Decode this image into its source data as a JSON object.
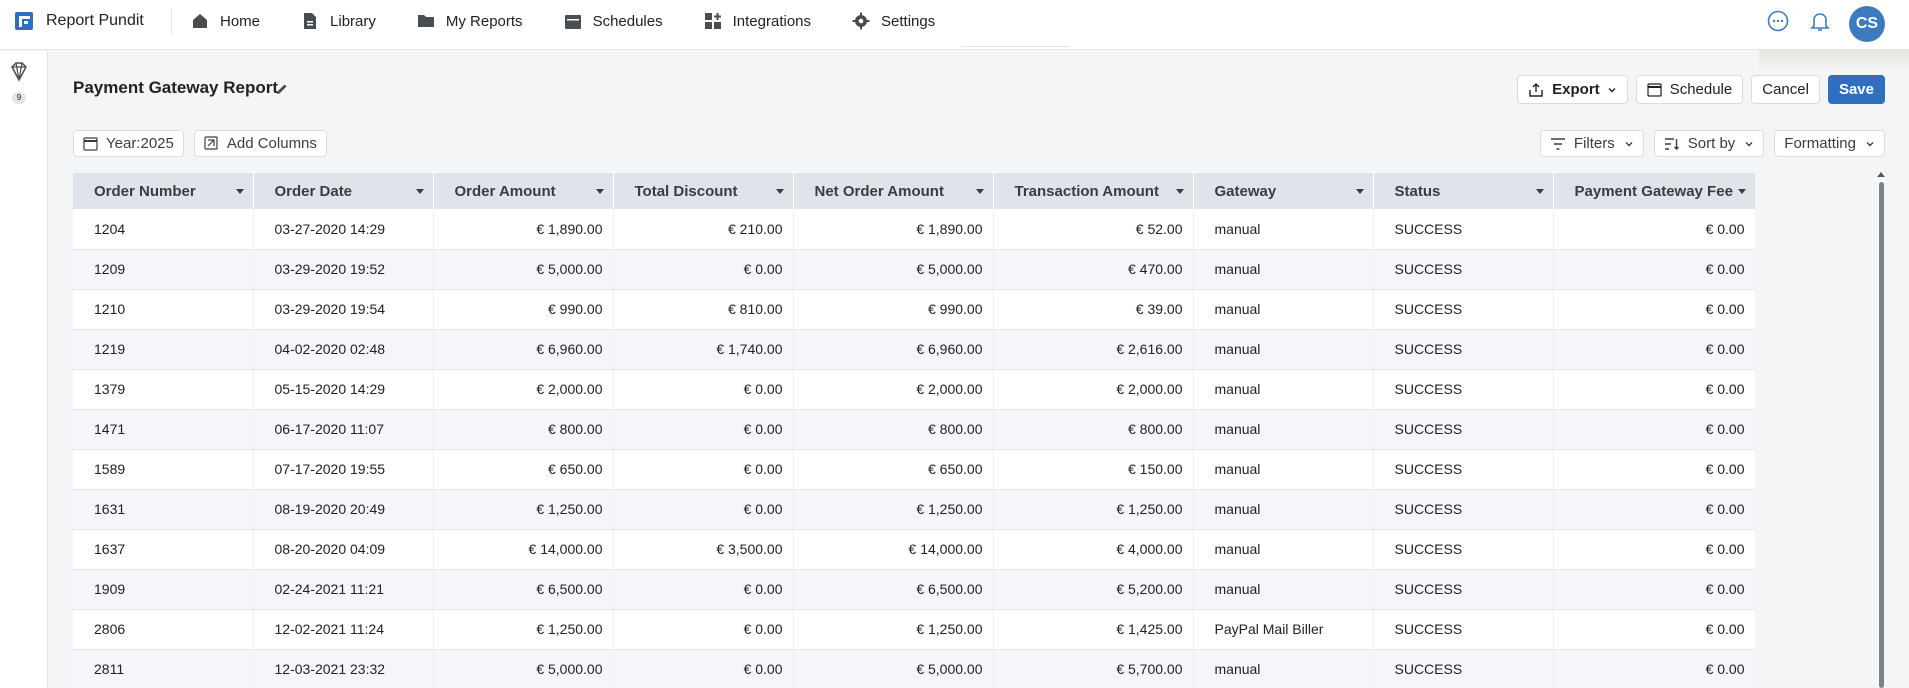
{
  "app": {
    "name": "Report Pundit"
  },
  "nav": {
    "items": [
      {
        "label": "Home",
        "icon": "home-icon"
      },
      {
        "label": "Library",
        "icon": "document-icon"
      },
      {
        "label": "My Reports",
        "icon": "folder-icon"
      },
      {
        "label": "Schedules",
        "icon": "calendar-icon"
      },
      {
        "label": "Integrations",
        "icon": "apps-icon"
      },
      {
        "label": "Settings",
        "icon": "gear-icon"
      }
    ],
    "avatar_initials": "CS"
  },
  "rail": {
    "badge": "9"
  },
  "report": {
    "title": "Payment Gateway Report"
  },
  "actions": {
    "export": "Export",
    "schedule": "Schedule",
    "cancel": "Cancel",
    "save": "Save"
  },
  "toolbar": {
    "year": "Year:2025",
    "add_columns": "Add Columns",
    "filters": "Filters",
    "sort_by": "Sort by",
    "formatting": "Formatting"
  },
  "table": {
    "columns": [
      "Order Number",
      "Order Date",
      "Order Amount",
      "Total Discount",
      "Net Order Amount",
      "Transaction Amount",
      "Gateway",
      "Status",
      "Payment Gateway Fee"
    ],
    "rows": [
      [
        "1204",
        "03-27-2020 14:29",
        "€ 1,890.00",
        "€ 210.00",
        "€ 1,890.00",
        "€ 52.00",
        "manual",
        "SUCCESS",
        "€ 0.00"
      ],
      [
        "1209",
        "03-29-2020 19:52",
        "€ 5,000.00",
        "€ 0.00",
        "€ 5,000.00",
        "€ 470.00",
        "manual",
        "SUCCESS",
        "€ 0.00"
      ],
      [
        "1210",
        "03-29-2020 19:54",
        "€ 990.00",
        "€ 810.00",
        "€ 990.00",
        "€ 39.00",
        "manual",
        "SUCCESS",
        "€ 0.00"
      ],
      [
        "1219",
        "04-02-2020 02:48",
        "€ 6,960.00",
        "€ 1,740.00",
        "€ 6,960.00",
        "€ 2,616.00",
        "manual",
        "SUCCESS",
        "€ 0.00"
      ],
      [
        "1379",
        "05-15-2020 14:29",
        "€ 2,000.00",
        "€ 0.00",
        "€ 2,000.00",
        "€ 2,000.00",
        "manual",
        "SUCCESS",
        "€ 0.00"
      ],
      [
        "1471",
        "06-17-2020 11:07",
        "€ 800.00",
        "€ 0.00",
        "€ 800.00",
        "€ 800.00",
        "manual",
        "SUCCESS",
        "€ 0.00"
      ],
      [
        "1589",
        "07-17-2020 19:55",
        "€ 650.00",
        "€ 0.00",
        "€ 650.00",
        "€ 150.00",
        "manual",
        "SUCCESS",
        "€ 0.00"
      ],
      [
        "1631",
        "08-19-2020 20:49",
        "€ 1,250.00",
        "€ 0.00",
        "€ 1,250.00",
        "€ 1,250.00",
        "manual",
        "SUCCESS",
        "€ 0.00"
      ],
      [
        "1637",
        "08-20-2020 04:09",
        "€ 14,000.00",
        "€ 3,500.00",
        "€ 14,000.00",
        "€ 4,000.00",
        "manual",
        "SUCCESS",
        "€ 0.00"
      ],
      [
        "1909",
        "02-24-2021 11:21",
        "€ 6,500.00",
        "€ 0.00",
        "€ 6,500.00",
        "€ 5,200.00",
        "manual",
        "SUCCESS",
        "€ 0.00"
      ],
      [
        "2806",
        "12-02-2021 11:24",
        "€ 1,250.00",
        "€ 0.00",
        "€ 1,250.00",
        "€ 1,425.00",
        "PayPal Mail Biller",
        "SUCCESS",
        "€ 0.00"
      ],
      [
        "2811",
        "12-03-2021 23:32",
        "€ 5,000.00",
        "€ 0.00",
        "€ 5,000.00",
        "€ 5,700.00",
        "manual",
        "SUCCESS",
        "€ 0.00"
      ]
    ]
  },
  "colors": {
    "accent": "#2f6fc0",
    "avatar": "#3d7bbf",
    "header_bg": "#dfe3ea",
    "stripe": "#f4f6f9"
  }
}
